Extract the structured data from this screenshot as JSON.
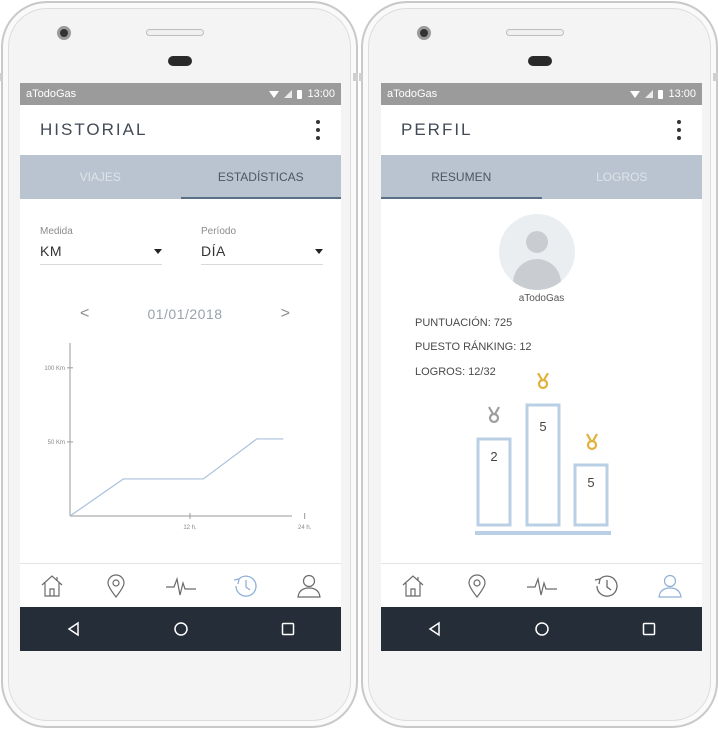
{
  "status_bar": {
    "app_name": "aTodoGas",
    "time": "13:00"
  },
  "left_screen": {
    "title": "HISTORIAL",
    "tabs": [
      {
        "label": "VIAJES",
        "active": false
      },
      {
        "label": "ESTADÍSTICAS",
        "active": true
      }
    ],
    "measure": {
      "label": "Medida",
      "value": "KM"
    },
    "period": {
      "label": "Período",
      "value": "DÍA"
    },
    "date_nav": {
      "prev": "<",
      "date": "01/01/2018",
      "next": ">"
    },
    "chart_data": {
      "type": "line",
      "x_ticks": [
        "12 h.",
        "24 h."
      ],
      "y_ticks": [
        "50 Km",
        "100 Km"
      ],
      "x": [
        0,
        4,
        10,
        14,
        16
      ],
      "y": [
        0,
        25,
        25,
        52,
        52
      ],
      "xlim": [
        0,
        18
      ],
      "ylim": [
        0,
        110
      ],
      "grid": false,
      "color": "#a9c1dc"
    }
  },
  "right_screen": {
    "title": "PERFIL",
    "tabs": [
      {
        "label": "RESUMEN",
        "active": true
      },
      {
        "label": "LOGROS",
        "active": false
      }
    ],
    "username": "aTodoGas",
    "stats": {
      "puntuacion": "PUNTUACIÓN: 725",
      "ranking": "PUESTO RÁNKING: 12",
      "logros": "LOGROS: 12/32"
    },
    "podium": [
      {
        "place": "2",
        "medal": "silver",
        "medal_color": "#9e9e9e"
      },
      {
        "place": "5",
        "medal": "gold",
        "medal_color": "#e2b13c"
      },
      {
        "place": "5",
        "medal": "gold",
        "medal_color": "#e2b13c"
      }
    ]
  },
  "bottom_nav_items": [
    "home-icon",
    "location-pin-icon",
    "activity-pulse-icon",
    "history-clock-icon",
    "profile-user-icon"
  ],
  "system_nav": [
    "back-icon",
    "home-circle-icon",
    "recents-square-icon"
  ],
  "colors": {
    "accent": "#a9c1dc",
    "tabbar": "#b9c4d0",
    "status_bar": "#9b9b9b",
    "system_bar": "#252d38",
    "gold": "#e2b13c",
    "silver": "#9e9e9e"
  }
}
